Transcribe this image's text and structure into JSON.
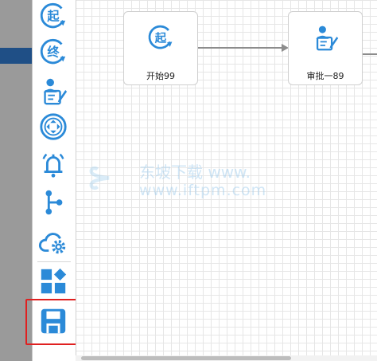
{
  "palette": {
    "items": [
      {
        "name": "start-node-tool",
        "icon": "start-node-icon",
        "glyph": "起"
      },
      {
        "name": "end-node-tool",
        "icon": "end-node-icon",
        "glyph": "终"
      },
      {
        "name": "approval-node-tool",
        "icon": "approval-node-icon",
        "glyph": ""
      },
      {
        "name": "gateway-node-tool",
        "icon": "gateway-node-icon",
        "glyph": ""
      },
      {
        "name": "notify-node-tool",
        "icon": "bell-icon",
        "glyph": ""
      },
      {
        "name": "branch-node-tool",
        "icon": "branch-icon",
        "glyph": ""
      },
      {
        "name": "service-node-tool",
        "icon": "cloud-gear-icon",
        "glyph": ""
      },
      {
        "name": "components-tool",
        "icon": "components-icon",
        "glyph": ""
      },
      {
        "name": "save-tool",
        "icon": "save-icon",
        "glyph": ""
      }
    ]
  },
  "nodes": {
    "start": {
      "label": "开始99",
      "glyph": "起",
      "icon": "start-node-icon"
    },
    "approval": {
      "label": "审批一89",
      "icon": "approval-node-icon"
    }
  },
  "watermark": {
    "line1": "东坡下载 www.",
    "line2": "www.iftpm.com"
  },
  "colors": {
    "accent": "#2b8ad8",
    "highlight": "#e02020",
    "grid": "#e6e6e6"
  }
}
